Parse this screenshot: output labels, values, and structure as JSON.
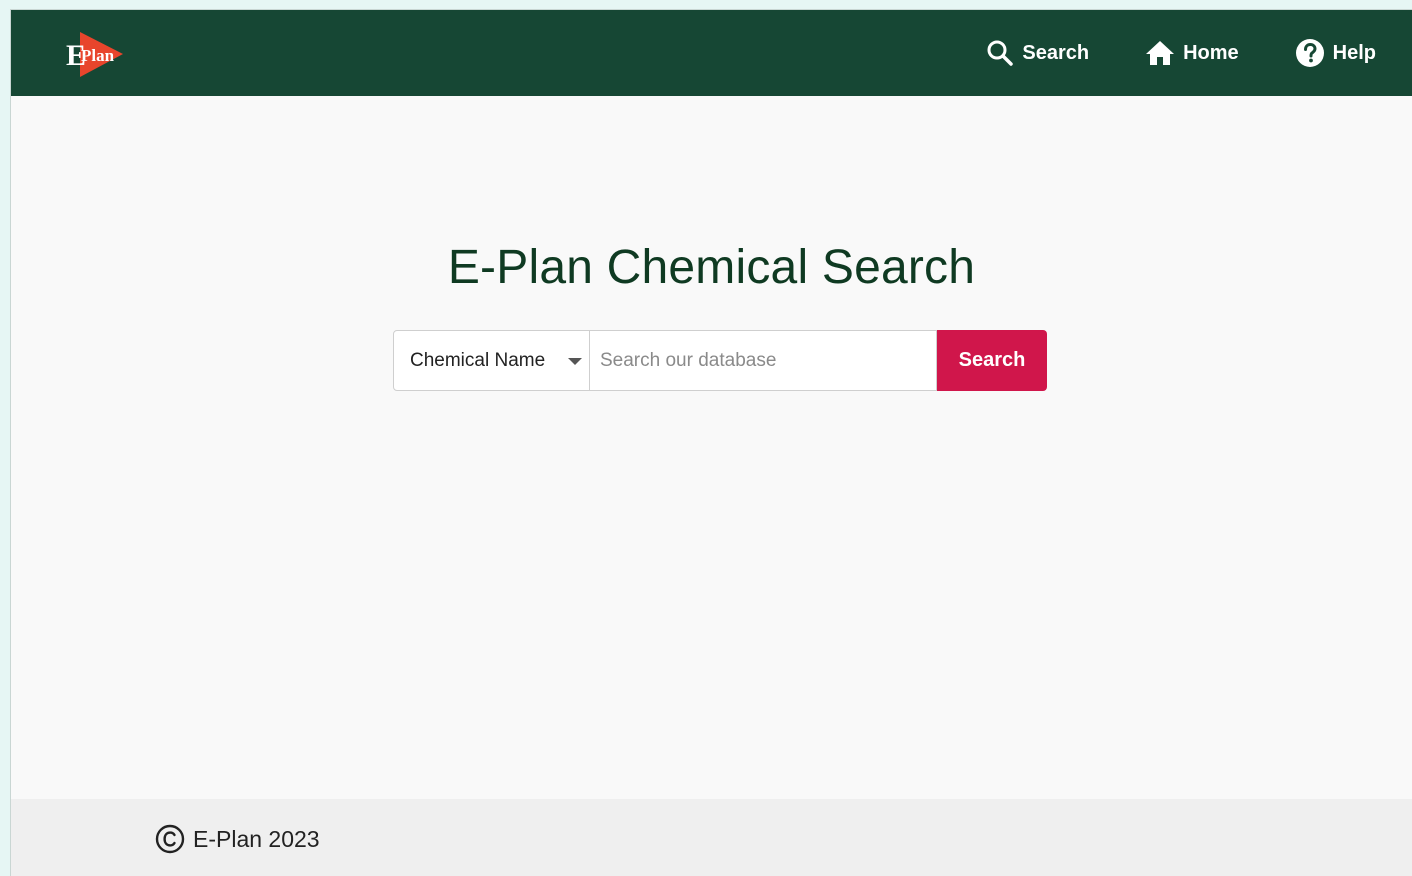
{
  "navbar": {
    "logo": {
      "text_big": "E",
      "text_small": "Plan",
      "accent_color": "#e8452c"
    },
    "background_color": "#164734",
    "links": [
      {
        "label": "Search",
        "icon": "search-icon"
      },
      {
        "label": "Home",
        "icon": "home-icon"
      },
      {
        "label": "Help",
        "icon": "help-icon"
      }
    ]
  },
  "main": {
    "title": "E-Plan Chemical Search",
    "search": {
      "select_value": "Chemical Name",
      "input_placeholder": "Search our database",
      "input_value": "",
      "button_label": "Search",
      "button_color": "#d0164b"
    }
  },
  "footer": {
    "copyright_icon": "copyright-icon",
    "text": "E-Plan 2023"
  }
}
